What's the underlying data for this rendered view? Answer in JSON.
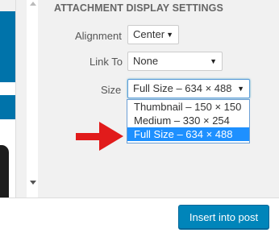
{
  "attachment_settings": {
    "title": "ATTACHMENT DISPLAY SETTINGS",
    "alignment": {
      "label": "Alignment",
      "value": "Center"
    },
    "link_to": {
      "label": "Link To",
      "value": "None"
    },
    "size": {
      "label": "Size",
      "value": "Full Size – 634 × 488",
      "options": [
        "Thumbnail – 150 × 150",
        "Medium – 330 × 254",
        "Full Size – 634 × 488"
      ]
    }
  },
  "footer": {
    "insert_label": "Insert into post"
  },
  "colors": {
    "accent": "#0085ba",
    "highlight": "#1e90ff",
    "annotation_arrow": "#e11b1b"
  }
}
